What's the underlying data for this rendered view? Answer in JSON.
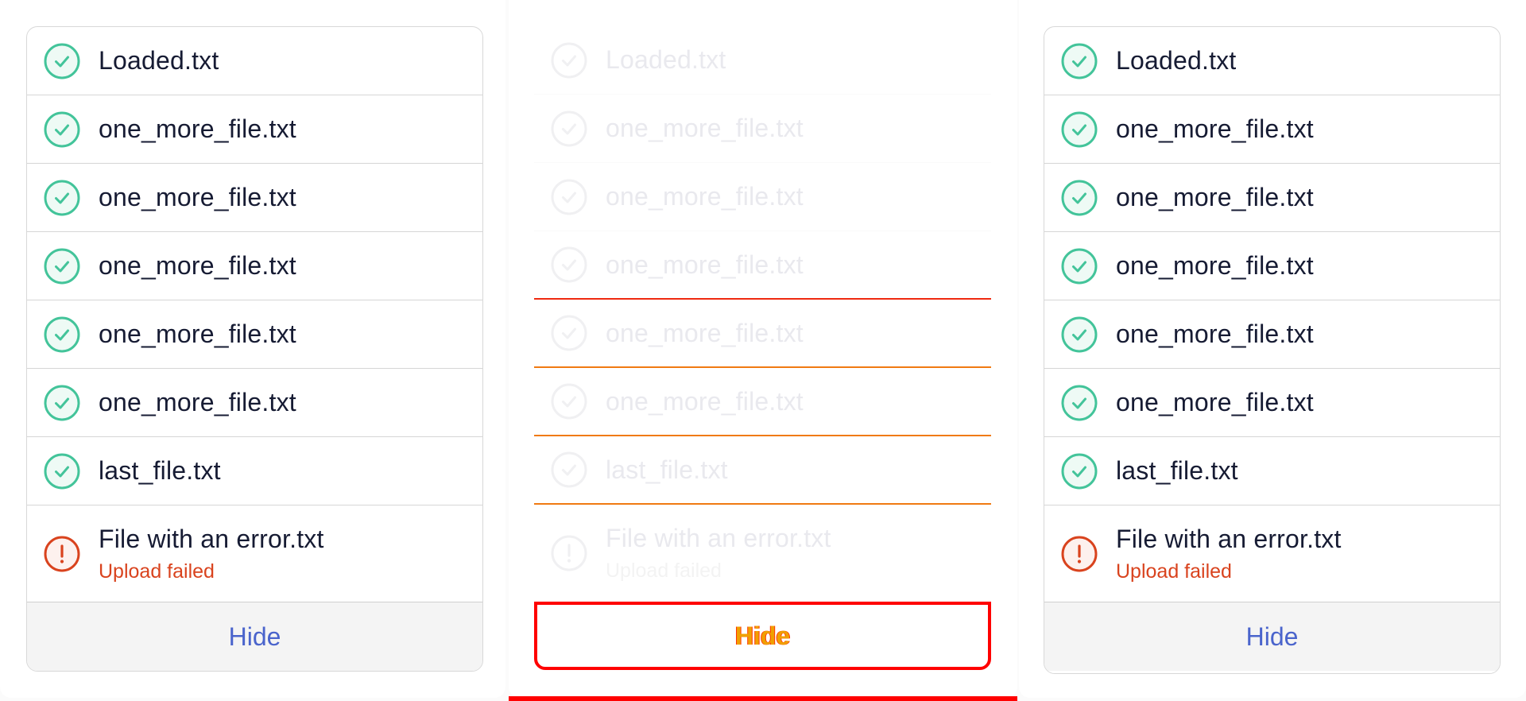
{
  "panels": [
    {
      "files": [
        {
          "name": "Loaded.txt",
          "status": "success"
        },
        {
          "name": "one_more_file.txt",
          "status": "success"
        },
        {
          "name": "one_more_file.txt",
          "status": "success"
        },
        {
          "name": "one_more_file.txt",
          "status": "success"
        },
        {
          "name": "one_more_file.txt",
          "status": "success"
        },
        {
          "name": "one_more_file.txt",
          "status": "success"
        },
        {
          "name": "last_file.txt",
          "status": "success"
        }
      ],
      "error_file": {
        "name": "File with an error.txt",
        "message": "Upload failed"
      },
      "hide_label": "Hide"
    },
    {
      "files": [
        {
          "name": "Loaded.txt",
          "status": "success"
        },
        {
          "name": "one_more_file.txt",
          "status": "success"
        },
        {
          "name": "one_more_file.txt",
          "status": "success"
        },
        {
          "name": "one_more_file.txt",
          "status": "success"
        },
        {
          "name": "one_more_file.txt",
          "status": "success"
        },
        {
          "name": "one_more_file.txt",
          "status": "success"
        },
        {
          "name": "last_file.txt",
          "status": "success"
        }
      ],
      "error_file": {
        "name": "File with an error.txt",
        "message": "Upload failed"
      },
      "hide_label": "Hide"
    },
    {
      "files": [
        {
          "name": "Loaded.txt",
          "status": "success"
        },
        {
          "name": "one_more_file.txt",
          "status": "success"
        },
        {
          "name": "one_more_file.txt",
          "status": "success"
        },
        {
          "name": "one_more_file.txt",
          "status": "success"
        },
        {
          "name": "one_more_file.txt",
          "status": "success"
        },
        {
          "name": "one_more_file.txt",
          "status": "success"
        },
        {
          "name": "last_file.txt",
          "status": "success"
        }
      ],
      "error_file": {
        "name": "File with an error.txt",
        "message": "Upload failed"
      },
      "hide_label": "Hide"
    }
  ],
  "icons": {
    "success": "check-circle-icon",
    "error": "exclamation-circle-icon"
  },
  "colors": {
    "success": "#43c49a",
    "error": "#d9431e",
    "text": "#161b33",
    "link": "#4a64cc",
    "faded_text": "#e9e9ee"
  }
}
